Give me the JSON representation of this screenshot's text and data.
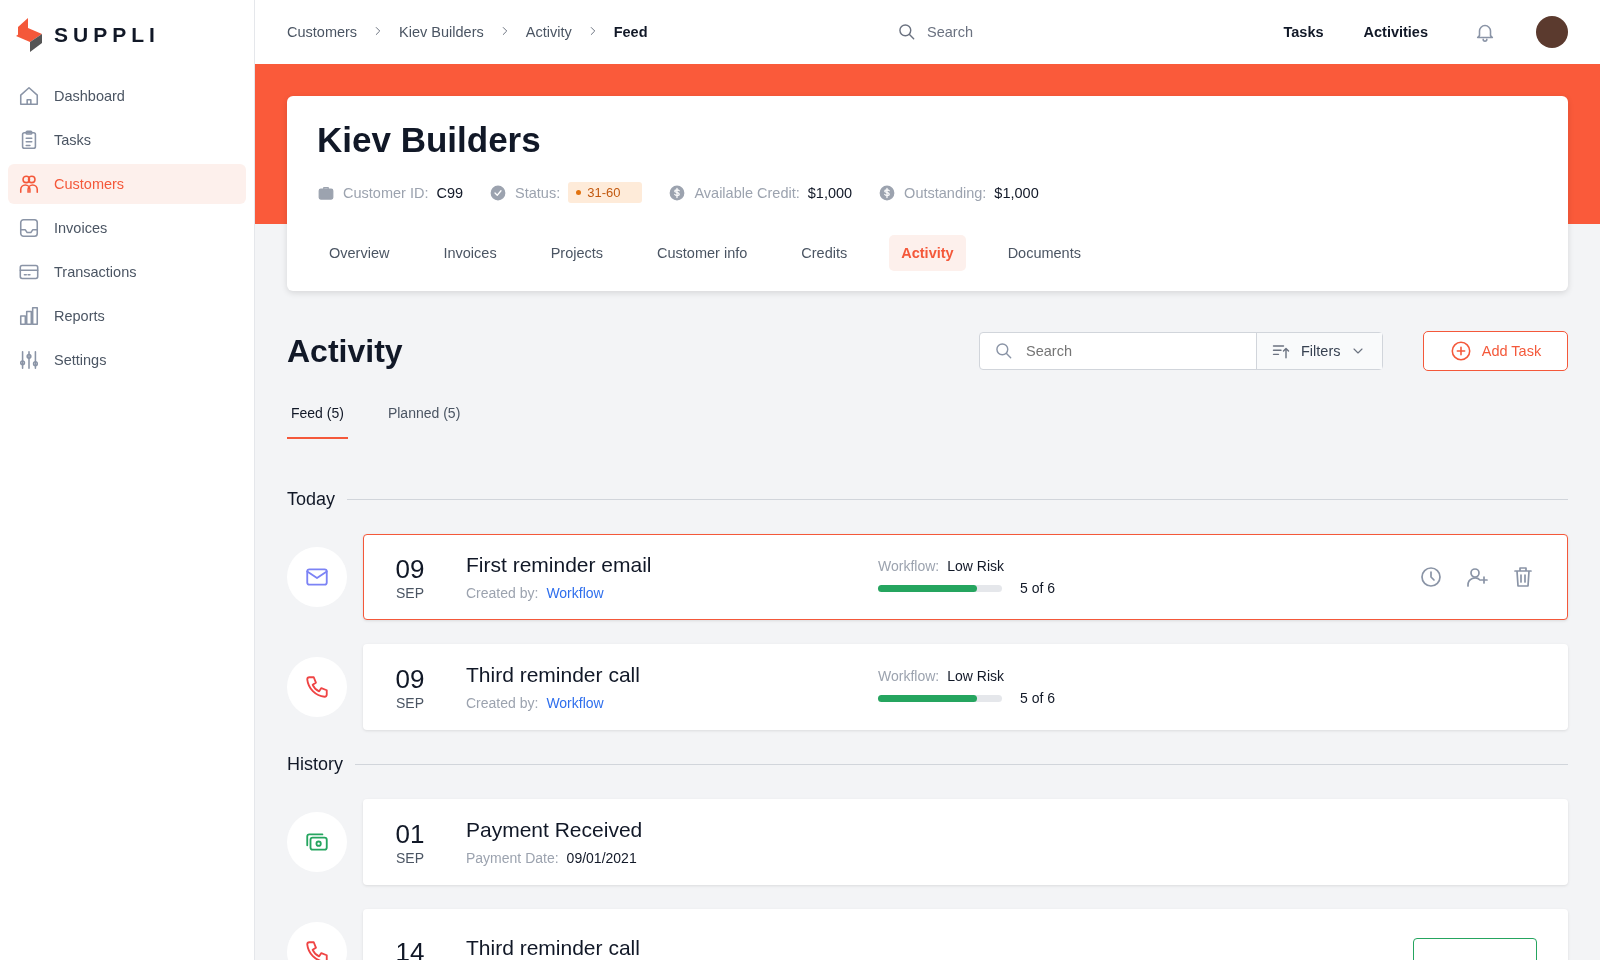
{
  "brand": {
    "name": "SUPPLI"
  },
  "sidebar": {
    "items": [
      {
        "label": "Dashboard",
        "selected": false
      },
      {
        "label": "Tasks",
        "selected": false
      },
      {
        "label": "Customers",
        "selected": true
      },
      {
        "label": "Invoices",
        "selected": false
      },
      {
        "label": "Transactions",
        "selected": false
      },
      {
        "label": "Reports",
        "selected": false
      },
      {
        "label": "Settings",
        "selected": false
      }
    ]
  },
  "breadcrumbs": [
    "Customers",
    "Kiev Builders",
    "Activity",
    "Feed"
  ],
  "top_search": {
    "placeholder": "Search"
  },
  "top_links": [
    "Tasks",
    "Activities"
  ],
  "customer": {
    "name": "Kiev Builders",
    "facts": [
      {
        "kind": "id",
        "label": "Customer ID:",
        "value": "C99"
      },
      {
        "kind": "status",
        "label": "Status:",
        "status": "31-60"
      },
      {
        "kind": "money",
        "label": "Available Credit:",
        "value": "$1,000"
      },
      {
        "kind": "money",
        "label": "Outstanding:",
        "value": "$1,000"
      }
    ],
    "tabs": [
      {
        "label": "Overview",
        "selected": false
      },
      {
        "label": "Invoices",
        "selected": false
      },
      {
        "label": "Projects",
        "selected": false
      },
      {
        "label": "Customer info",
        "selected": false
      },
      {
        "label": "Credits",
        "selected": false
      },
      {
        "label": "Activity",
        "selected": true
      },
      {
        "label": "Documents",
        "selected": false
      }
    ]
  },
  "activity": {
    "title": "Activity",
    "search": {
      "placeholder": "Search"
    },
    "filters": "Filters",
    "add_button": "Add Task",
    "tabs": [
      {
        "label": "Feed (5)",
        "selected": true
      },
      {
        "label": "Planned (5)",
        "selected": false
      }
    ],
    "sections": [
      {
        "title": "Today",
        "items": [
          {
            "kind": "email",
            "selected": true,
            "day": "09",
            "month": "SEP",
            "title": "First reminder email",
            "sub_label": "Created by:",
            "sub_value": "Workflow",
            "workflow_label": "Workflow:",
            "workflow": "Low Risk",
            "level": 0.8,
            "progress": "5 of 6"
          },
          {
            "kind": "call",
            "selected": false,
            "day": "09",
            "month": "SEP",
            "title": "Third reminder call",
            "sub_label": "Created by:",
            "sub_value": "Workflow",
            "workflow_label": "Workflow:",
            "workflow": "Low Risk",
            "level": 0.8,
            "progress": "5 of 6"
          }
        ]
      },
      {
        "title": "History",
        "items": [
          {
            "kind": "payment",
            "selected": false,
            "day": "01",
            "month": "SEP",
            "title": "Payment Received",
            "sub_label": "Payment Date:",
            "sub_value": "09/01/2021"
          },
          {
            "kind": "call",
            "selected": false,
            "day": "14",
            "title": "Third reminder call",
            "status_badge": true
          }
        ]
      }
    ]
  }
}
